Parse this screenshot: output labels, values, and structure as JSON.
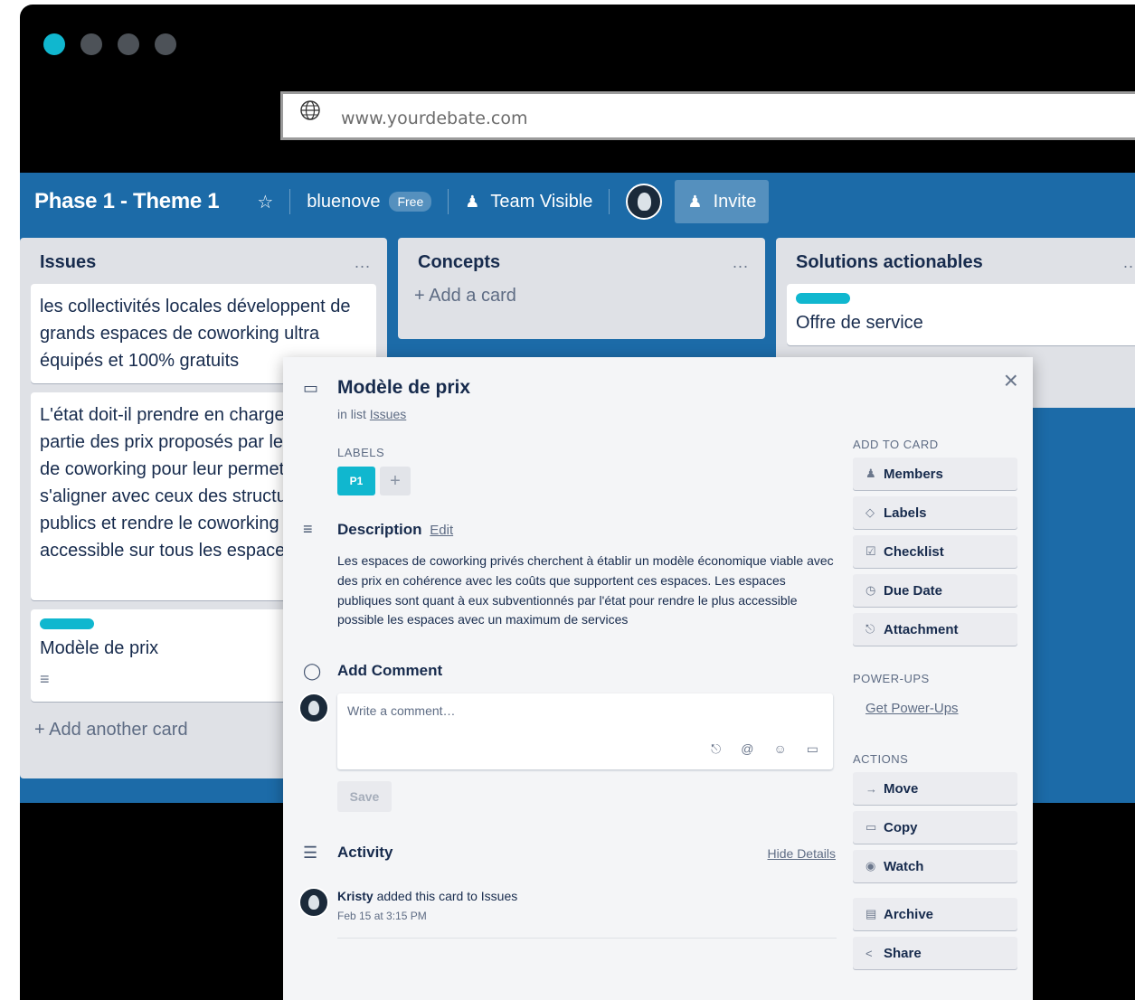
{
  "browser": {
    "url": "www.yourdebate.com"
  },
  "board": {
    "title": "Phase 1 - Theme 1",
    "team": "bluenove",
    "plan_badge": "Free",
    "visibility": "Team Visible",
    "invite_label": "Invite"
  },
  "lists": [
    {
      "title": "Issues",
      "menu": "...",
      "cards": [
        {
          "text": "les collectivités locales développent de grands espaces de coworking ultra équipés et 100% gratuits"
        },
        {
          "text": "L'état doit-il prendre en charge une partie des prix proposés par les espaces de coworking pour leur permettre de s'aligner avec ceux des structures publics et rendre le coworking ultra accessible sur tous les espaces"
        },
        {
          "text": "Modèle de prix"
        }
      ],
      "add_label": "+ Add another card"
    },
    {
      "title": "Concepts",
      "menu": "...",
      "add_label": "+ Add a card"
    },
    {
      "title": "Solutions actionables",
      "menu": "...",
      "cards": [
        {
          "text": "Offre de service"
        }
      ]
    }
  ],
  "modal": {
    "title": "Modèle de prix",
    "in_list_prefix": "in list",
    "in_list_name": "Issues",
    "labels_heading": "LABELS",
    "label_p1": "P1",
    "label_add": "+",
    "description_heading": "Description",
    "edit_link": "Edit",
    "description": "Les espaces de coworking privés cherchent à établir un modèle économique viable avec des prix en cohérence avec les coûts que supportent ces espaces. Les espaces publiques sont quant à eux subventionnés par l'état pour rendre le plus accessible possible les espaces avec un maximum de services",
    "add_comment_heading": "Add Comment",
    "comment_placeholder": "Write a comment…",
    "save_label": "Save",
    "activity_heading": "Activity",
    "hide_details": "Hide Details",
    "activity": {
      "user": "Kristy",
      "action": "added this card to Issues",
      "time": "Feb 15 at 3:15 PM"
    },
    "close": "×",
    "sidebar": {
      "add_to_card_heading": "ADD TO CARD",
      "members": "Members",
      "labels": "Labels",
      "checklist": "Checklist",
      "due_date": "Due Date",
      "attachment": "Attachment",
      "powerups_heading": "POWER-UPS",
      "get_powerups": "Get Power-Ups",
      "actions_heading": "ACTIONS",
      "move": "Move",
      "copy": "Copy",
      "watch": "Watch",
      "archive": "Archive",
      "share": "Share"
    }
  },
  "colors": {
    "board_blue": "#1c6ba8",
    "accent_cyan": "#10b7cf"
  }
}
